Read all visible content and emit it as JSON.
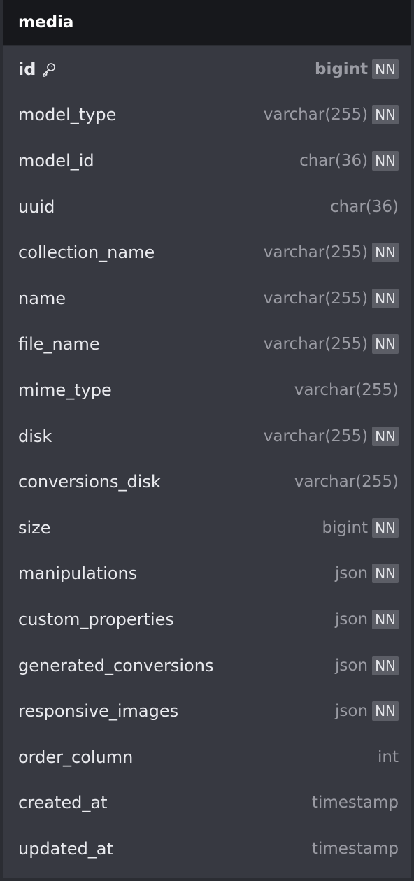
{
  "table": {
    "name": "media",
    "columns": [
      {
        "name": "id",
        "type": "bigint",
        "nn": true,
        "primary_key": true,
        "nn_label": "NN"
      },
      {
        "name": "model_type",
        "type": "varchar(255)",
        "nn": true,
        "nn_label": "NN"
      },
      {
        "name": "model_id",
        "type": "char(36)",
        "nn": true,
        "nn_label": "NN"
      },
      {
        "name": "uuid",
        "type": "char(36)",
        "nn": false
      },
      {
        "name": "collection_name",
        "type": "varchar(255)",
        "nn": true,
        "nn_label": "NN"
      },
      {
        "name": "name",
        "type": "varchar(255)",
        "nn": true,
        "nn_label": "NN"
      },
      {
        "name": "file_name",
        "type": "varchar(255)",
        "nn": true,
        "nn_label": "NN"
      },
      {
        "name": "mime_type",
        "type": "varchar(255)",
        "nn": false
      },
      {
        "name": "disk",
        "type": "varchar(255)",
        "nn": true,
        "nn_label": "NN"
      },
      {
        "name": "conversions_disk",
        "type": "varchar(255)",
        "nn": false
      },
      {
        "name": "size",
        "type": "bigint",
        "nn": true,
        "nn_label": "NN"
      },
      {
        "name": "manipulations",
        "type": "json",
        "nn": true,
        "nn_label": "NN"
      },
      {
        "name": "custom_properties",
        "type": "json",
        "nn": true,
        "nn_label": "NN"
      },
      {
        "name": "generated_conversions",
        "type": "json",
        "nn": true,
        "nn_label": "NN"
      },
      {
        "name": "responsive_images",
        "type": "json",
        "nn": true,
        "nn_label": "NN"
      },
      {
        "name": "order_column",
        "type": "int",
        "nn": false
      },
      {
        "name": "created_at",
        "type": "timestamp",
        "nn": false
      },
      {
        "name": "updated_at",
        "type": "timestamp",
        "nn": false
      }
    ]
  },
  "icons": {
    "primary_key": "key-icon"
  },
  "colors": {
    "header_bg": "#17181c",
    "body_bg": "#373941",
    "text": "#e9eaee",
    "type_text": "#9a9ba3",
    "nn_badge_bg": "#5c5e66"
  }
}
